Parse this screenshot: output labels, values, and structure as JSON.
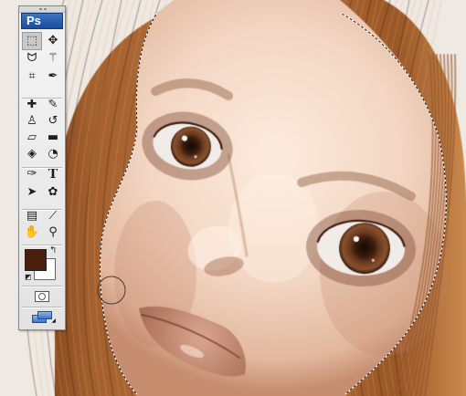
{
  "app": {
    "logo": "Ps"
  },
  "colors": {
    "foreground": "#4a200c",
    "background": "#ffffff",
    "skin_light": "#f3d6c3",
    "skin_shadow": "#c68d6f",
    "hair_dark": "#5a2a0f",
    "hair_light": "#c98a52",
    "iris": "#6b3a1f"
  },
  "tools": [
    {
      "name": "rect-marquee-icon",
      "glyph": "⬚",
      "active": true
    },
    {
      "name": "move-icon",
      "glyph": "✥"
    },
    {
      "name": "lasso-icon",
      "glyph": "ᗢ"
    },
    {
      "name": "magic-wand-icon",
      "glyph": "⚚"
    },
    {
      "name": "crop-icon",
      "glyph": "⌗"
    },
    {
      "name": "eyedropper-slice-icon",
      "glyph": "✒"
    },
    {
      "name": "healing-brush-icon",
      "glyph": "✚"
    },
    {
      "name": "brush-icon",
      "glyph": "✎"
    },
    {
      "name": "clone-stamp-icon",
      "glyph": "♙"
    },
    {
      "name": "history-brush-icon",
      "glyph": "↺"
    },
    {
      "name": "eraser-icon",
      "glyph": "▱"
    },
    {
      "name": "gradient-icon",
      "glyph": "▬"
    },
    {
      "name": "blur-icon",
      "glyph": "◈"
    },
    {
      "name": "dodge-icon",
      "glyph": "◔"
    },
    {
      "name": "pen-icon",
      "glyph": "✑"
    },
    {
      "name": "type-icon",
      "glyph": "T",
      "serif": true
    },
    {
      "name": "path-select-icon",
      "glyph": "➤"
    },
    {
      "name": "custom-shape-icon",
      "glyph": "✿"
    },
    {
      "name": "notes-icon",
      "glyph": "▤"
    },
    {
      "name": "eyedropper-icon",
      "glyph": "⟋"
    },
    {
      "name": "hand-icon",
      "glyph": "✋"
    },
    {
      "name": "zoom-icon",
      "glyph": "⚲"
    }
  ]
}
